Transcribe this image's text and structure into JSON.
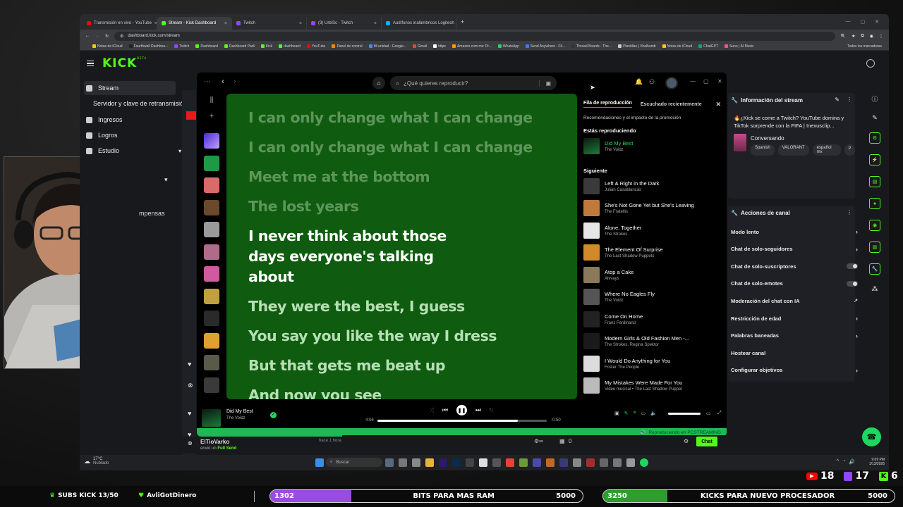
{
  "browser": {
    "tabs": [
      {
        "label": "Transmisión en vivo - YouTube",
        "color": "#ff0000"
      },
      {
        "label": "Stream - Kick Dashboard",
        "color": "#53fc18"
      },
      {
        "label": "Twitch",
        "color": "#9146ff"
      },
      {
        "label": "(3) UrbiSc - Twitch",
        "color": "#9146ff"
      },
      {
        "label": "Audífonos inalámbricos Logitech",
        "color": "#00b8fc"
      }
    ],
    "url": "dashboard.kick.com/stream",
    "bookmarks": [
      "Notas de iCloud",
      "Fourthwall Dashboa...",
      "Twitch",
      "Dashboard",
      "Dashboard Padi",
      "Kick",
      "dashboard",
      "YouTube",
      "Panel de control",
      "Mi unidad - Google...",
      "Gmail",
      "https",
      "Amazon.com.mx: Pr...",
      "WhatsApp",
      "Send Anywhere - Fil...",
      "Thread Boards - The...",
      "Plantillas | Viralhumb",
      "Notas de iCloud",
      "ChatGPT",
      "Suno | AI Music"
    ],
    "bookmarks_all": "Todos los marcadores"
  },
  "kick": {
    "logo": "KICK",
    "logo_sup": "BETA",
    "nav": [
      {
        "label": "Stream",
        "icon": "stream-icon",
        "selected": true
      },
      {
        "label": "Servidor y clave de retransmisión",
        "icon": "",
        "selected": false
      },
      {
        "label": "Ingresos",
        "icon": "revenue-icon",
        "selected": false
      },
      {
        "label": "Logros",
        "icon": "trophy-icon",
        "selected": false
      },
      {
        "label": "Estudio",
        "icon": "studio-icon",
        "selected": false
      }
    ],
    "nav_extra": "mpensas",
    "stream_info": {
      "title": "Información del stream",
      "stream_title": "🔥¿Kick se come a Twitch? YouTube domina y TikTok sorprende con la FIFA | Inexusclip...",
      "category": "Conversando",
      "tags": [
        "Spanish",
        "VALORANT",
        "español mx",
        "p"
      ]
    },
    "channel_actions": {
      "title": "Acciones de canal",
      "items": [
        {
          "label": "Modo lento",
          "kind": "chevron"
        },
        {
          "label": "Chat de solo-seguidores",
          "kind": "chevron"
        },
        {
          "label": "Chat de solo-suscriptores",
          "kind": "toggle"
        },
        {
          "label": "Chat de solo-emotes",
          "kind": "toggle"
        },
        {
          "label": "Moderación del chat con IA",
          "kind": "external"
        },
        {
          "label": "Restricción de edad",
          "kind": "chevron"
        },
        {
          "label": "Palabras baneadas",
          "kind": "chevron"
        },
        {
          "label": "Hostear canal",
          "kind": "none"
        },
        {
          "label": "Configurar objetivos",
          "kind": "chevron"
        }
      ]
    },
    "chat": {
      "user": "ElTioVarko",
      "time": "hace 1 hora",
      "note_prefix": "envió un",
      "note_item": "Full Send",
      "count": "0",
      "send_label": "Chat"
    }
  },
  "spotify": {
    "search_placeholder": "¿Qué quieres reproducir?",
    "lyrics": [
      {
        "text": "I can only change what I can change",
        "state": "past"
      },
      {
        "text": "I can only change what I can change",
        "state": "past"
      },
      {
        "text": "Meet me at the bottom",
        "state": "past"
      },
      {
        "text": "The lost years",
        "state": "past"
      },
      {
        "text": "I never think about those days everyone's talking about",
        "state": "cur"
      },
      {
        "text": "They were the best, I guess",
        "state": "fut"
      },
      {
        "text": "You say you like the way I dress",
        "state": "fut"
      },
      {
        "text": "But that gets me beat up",
        "state": "fut"
      },
      {
        "text": "And now you see",
        "state": "fut"
      }
    ],
    "queue": {
      "tab_queue": "Fila de reproducción",
      "tab_recent": "Escuchado recientemente",
      "subtitle": "Recomendaciones y el impacto de la promoción",
      "now_playing_label": "Estás reproduciendo",
      "now_playing": {
        "title": "Did My Best",
        "artist": "The Voidz"
      },
      "next_label": "Siguiente",
      "next": [
        {
          "title": "Left & Right in the Dark",
          "artist": "Julian Casablancas",
          "color": "#3a3a3a"
        },
        {
          "title": "She's Not Gone Yet but She's Leaving",
          "artist": "The Fratellis",
          "color": "#c27a3c"
        },
        {
          "title": "Alone, Together",
          "artist": "The Strokes",
          "color": "#e6e6e6"
        },
        {
          "title": "The Element Of Surprise",
          "artist": "The Last Shadow Puppets",
          "color": "#d08a2a"
        },
        {
          "title": "Atop a Cake",
          "artist": "Alvvays",
          "color": "#8a7a5a"
        },
        {
          "title": "Where No Eagles Fly",
          "artist": "The Voidz",
          "color": "#555555"
        },
        {
          "title": "Come On Home",
          "artist": "Franz Ferdinand",
          "color": "#222222"
        },
        {
          "title": "Modern Girls & Old Fashion Men -...",
          "artist": "The Strokes, Regina Spektor",
          "color": "#1a1a1a"
        },
        {
          "title": "I Would Do Anything for You",
          "artist": "Foster The People",
          "color": "#dcdcdc"
        },
        {
          "title": "My Mistakes Were Made For You",
          "artist": "Video musical • The Last Shadow Puppet",
          "color": "#bbbbbb"
        }
      ]
    },
    "player": {
      "title": "Did My Best",
      "artist": "The Voidz",
      "elapsed": "4:06",
      "remaining": "-0:50",
      "progress": 0.83,
      "device": "Reproduciendo en PCSTREAMING"
    }
  },
  "taskbar": {
    "weather_temp": "17°C",
    "weather_desc": "Nublado",
    "search": "Buscar",
    "time": "9:09 PM",
    "date": "1/13/2026"
  },
  "overlay": {
    "subs": "SUBS KICK 13/50",
    "donation": "AvliGotDinero",
    "bits_current": "1302",
    "bits_label": "BITS PARA MAS RAM",
    "bits_goal": "5000",
    "bits_progress": 0.26,
    "kicks_current": "3250",
    "kicks_label": "KICKS PARA NUEVO PROCESADOR",
    "kicks_goal": "5000",
    "kicks_progress": 0.22,
    "youtube_viewers": "18",
    "twitch_viewers": "17",
    "kick_viewers": "6"
  }
}
